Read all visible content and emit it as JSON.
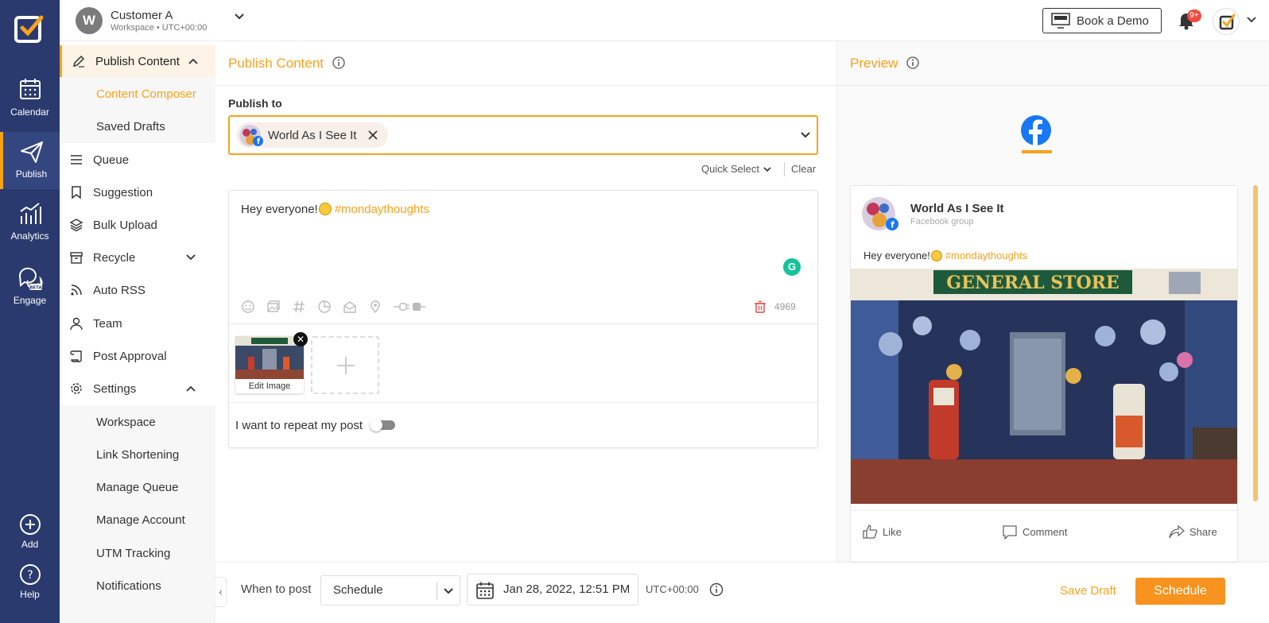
{
  "rail": {
    "items": [
      {
        "label": "Calendar",
        "icon": "calendar-icon"
      },
      {
        "label": "Publish",
        "icon": "paper-plane-icon"
      },
      {
        "label": "Analytics",
        "icon": "analytics-icon"
      },
      {
        "label": "Engage",
        "icon": "engage-icon",
        "badge": "BETA"
      },
      {
        "label": "Add",
        "icon": "plus-circle-icon"
      },
      {
        "label": "Help",
        "icon": "help-icon"
      }
    ]
  },
  "topbar": {
    "workspace_initial": "W",
    "workspace_name": "Customer A",
    "workspace_sub": "Workspace • UTC+00:00",
    "demo_label": "Book a Demo",
    "notifications_badge": "9+"
  },
  "submenu": {
    "publish_content": "Publish Content",
    "content_composer": "Content Composer",
    "saved_drafts": "Saved Drafts",
    "queue": "Queue",
    "suggestion": "Suggestion",
    "bulk_upload": "Bulk Upload",
    "recycle": "Recycle",
    "auto_rss": "Auto RSS",
    "team": "Team",
    "post_approval": "Post Approval",
    "settings": "Settings",
    "workspace": "Workspace",
    "link_shortening": "Link Shortening",
    "manage_queue": "Manage Queue",
    "manage_account": "Manage Account",
    "utm_tracking": "UTM Tracking",
    "notifications": "Notifications"
  },
  "main": {
    "title": "Publish Content",
    "publish_to_label": "Publish to",
    "selected_account": "World As I See It",
    "quick_select": "Quick Select",
    "clear": "Clear",
    "post_text": "Hey everyone!",
    "post_hashtag": "#mondaythoughts",
    "grammarly_letter": "G",
    "char_count": "4969",
    "edit_image": "Edit Image",
    "repeat_label": "I want to repeat my post"
  },
  "preview": {
    "title": "Preview",
    "account_name": "World As I See It",
    "account_type": "Facebook group",
    "post_text": "Hey everyone!",
    "post_hashtag": "#mondaythoughts",
    "image_sign": "GENERAL STORE",
    "like": "Like",
    "comment": "Comment",
    "share": "Share"
  },
  "bottombar": {
    "when_label": "When to post",
    "schedule_option": "Schedule",
    "date_value": "Jan 28, 2022, 12:51 PM",
    "timezone": "UTC+00:00",
    "save_draft": "Save Draft",
    "schedule_button": "Schedule"
  },
  "colors": {
    "accent": "#f7a21b",
    "rail": "#2a3a6e",
    "facebook": "#1877f2"
  }
}
